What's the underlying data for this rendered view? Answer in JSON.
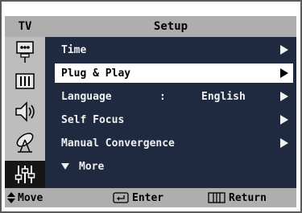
{
  "header": {
    "tv_label": "TV",
    "title": "Setup"
  },
  "sidebar": {
    "icons": [
      {
        "name": "picture-icon"
      },
      {
        "name": "sound-icon"
      },
      {
        "name": "speaker-icon"
      },
      {
        "name": "antenna-icon"
      },
      {
        "name": "setup-icon",
        "active": true
      }
    ]
  },
  "menu": {
    "items": [
      {
        "label": "Time",
        "arrow": true
      },
      {
        "label": "Plug & Play",
        "arrow": true,
        "selected": true
      },
      {
        "label": "Language",
        "separator": ":",
        "value": "English",
        "arrow": true
      },
      {
        "label": "Self Focus",
        "arrow": true
      },
      {
        "label": "Manual Convergence",
        "arrow": true
      },
      {
        "label": "More",
        "more": true
      }
    ]
  },
  "footer": {
    "move_label": "Move",
    "enter_label": "Enter",
    "return_label": "Return"
  },
  "colors": {
    "menu_bg": "#1f2a40",
    "bar_gray": "#aeaeae",
    "selected_bg": "#ffffff"
  }
}
